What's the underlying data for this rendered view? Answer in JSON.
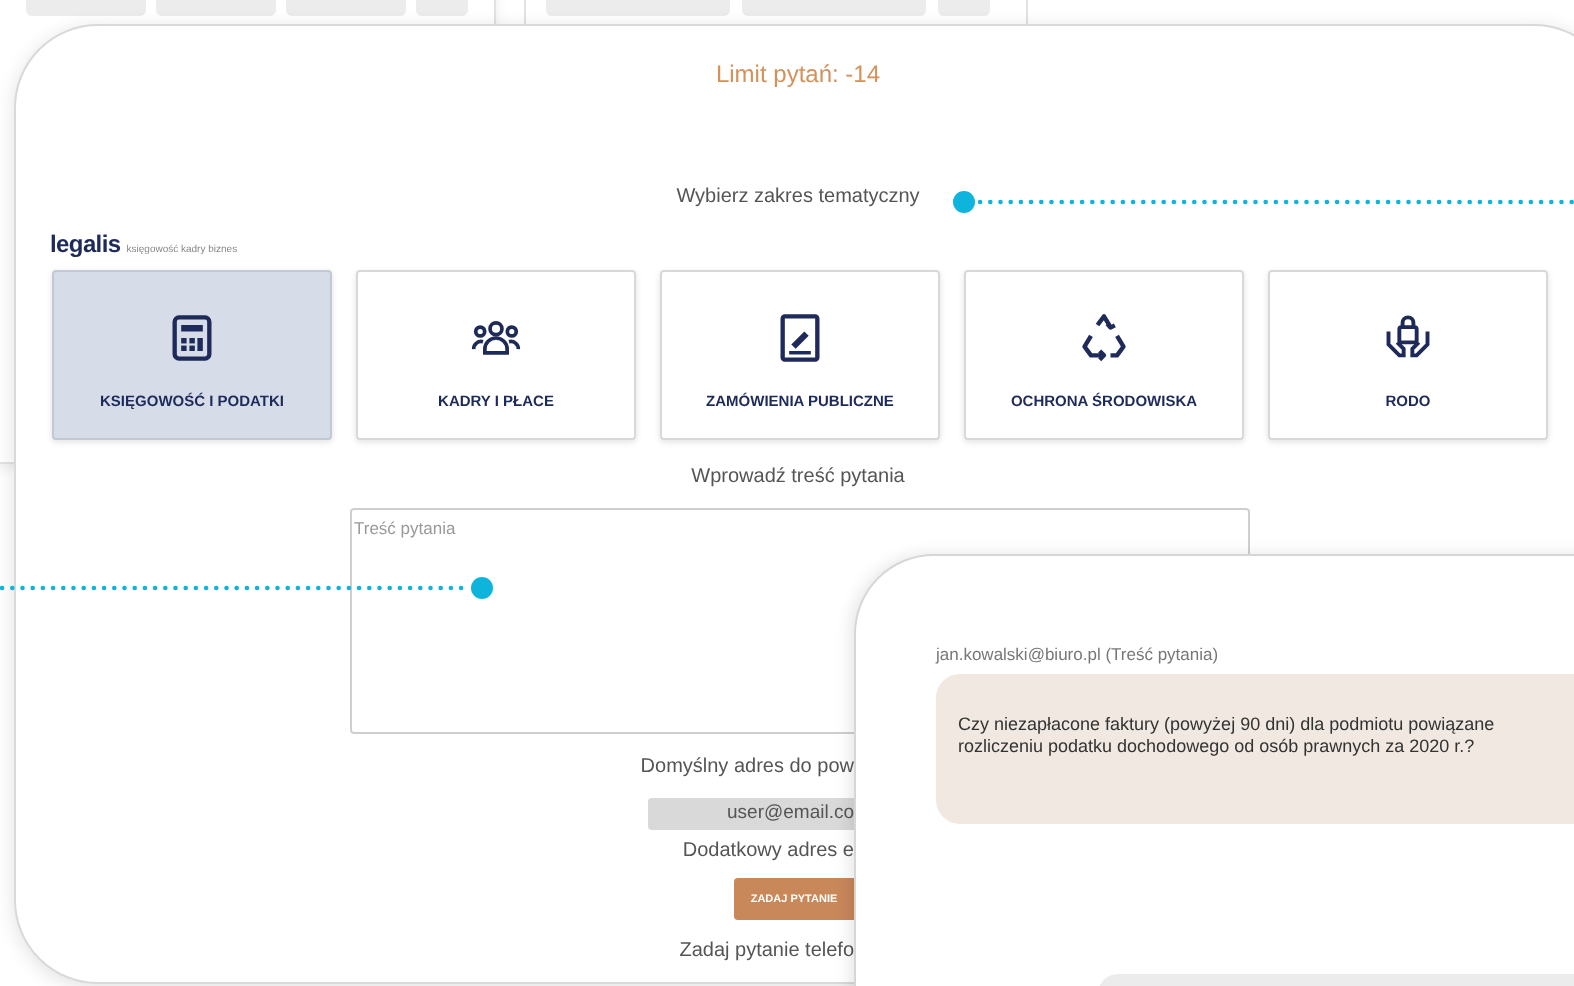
{
  "limit_title": "Limit pytań: -14",
  "topic_prompt": "Wybierz zakres tematyczny",
  "logo": {
    "name": "legalis",
    "tagline": "księgowość kadry biznes"
  },
  "topics": [
    {
      "label": "KSIĘGOWOŚĆ I PODATKI",
      "kind": "calculator",
      "selected": true
    },
    {
      "label": "KADRY I PŁACE",
      "kind": "people",
      "selected": false
    },
    {
      "label": "ZAMÓWIENIA PUBLICZNE",
      "kind": "document",
      "selected": false
    },
    {
      "label": "OCHRONA ŚRODOWISKA",
      "kind": "recycle",
      "selected": false
    },
    {
      "label": "RODO",
      "kind": "lock",
      "selected": false
    }
  ],
  "question_prompt": "Wprowadź treść pytania",
  "question_field": {
    "placeholder": "Treść pytania"
  },
  "default_email_label": "Domyślny adres do pow",
  "email_field": {
    "value": "user@email.co"
  },
  "extra_email_label": "Dodatkowy adres e",
  "submit_button": "ZADAJ PYTANIE",
  "phone_label": "Zadaj pytanie telefo",
  "preview": {
    "sender": "jan.kowalski@biuro.pl (Treść pytania)",
    "lines": [
      "Czy niezapłacone faktury (powyżej 90 dni) dla podmiotu powiązane",
      "rozliczeniu podatku dochodowego od osób prawnych za 2020 r.?"
    ]
  }
}
